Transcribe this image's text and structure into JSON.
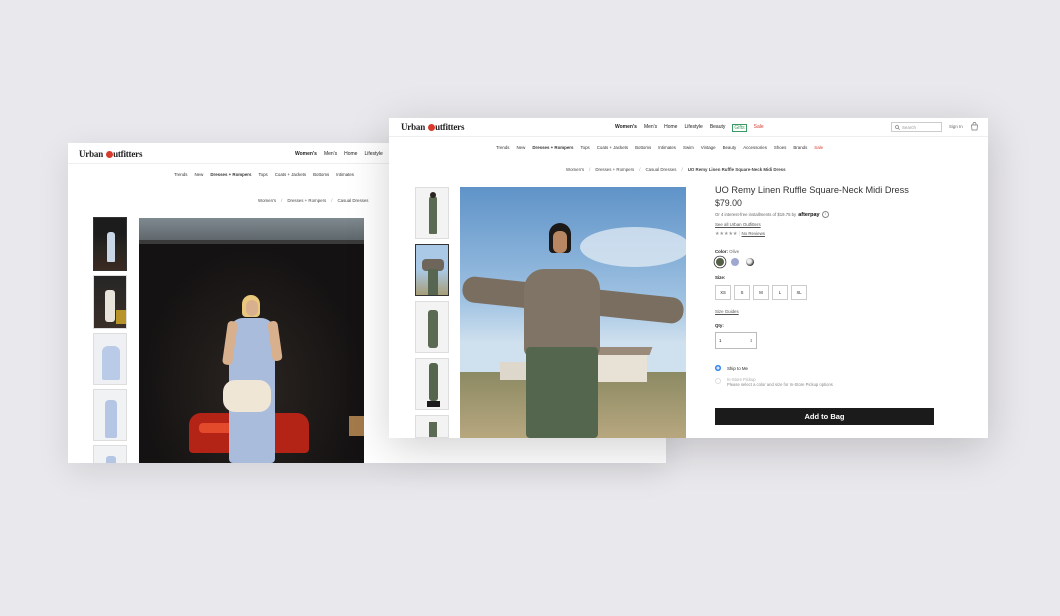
{
  "back_window": {
    "logo": {
      "pre": "Urban ",
      "post": "utfitters"
    },
    "top_nav": [
      "Women's",
      "Men's",
      "Home",
      "Lifestyle"
    ],
    "sub_nav": [
      "Trends",
      "New",
      "Dresses + Rompers",
      "Tops",
      "Coats + Jackets",
      "Bottoms",
      "Intimates"
    ],
    "breadcrumb": [
      "Women's",
      "Dresses + Rompers",
      "Casual Dresses"
    ]
  },
  "front_window": {
    "logo": {
      "pre": "Urban ",
      "post": "utfitters"
    },
    "top_nav": [
      "Women's",
      "Men's",
      "Home",
      "Lifestyle",
      "Beauty",
      "Gifts",
      "Sale"
    ],
    "search_placeholder": "Search",
    "sign_in": "Sign In",
    "sub_nav": [
      "Trends",
      "New",
      "Dresses + Rompers",
      "Tops",
      "Coats + Jackets",
      "Bottoms",
      "Intimates",
      "Swim",
      "Vintage",
      "Beauty",
      "Accessories",
      "Shoes",
      "Brands",
      "Sale"
    ],
    "breadcrumb": [
      "Women's",
      "Dresses + Rompers",
      "Casual Dresses",
      "UO Remy Linen Ruffle Square-Neck Midi Dress"
    ],
    "product": {
      "title": "UO Remy Linen Ruffle Square-Neck Midi Dress",
      "price": "$79.00",
      "installments": "Or 4 interest-free installments of $19.75 by",
      "afterpay": "afterpay",
      "see_all": "See all Urban Outfitters",
      "stars": "★★★★★",
      "reviews": "No Reviews",
      "color_label": "Color:",
      "color_value": "Olive",
      "size_label": "Size:",
      "sizes": [
        "XS",
        "S",
        "M",
        "L",
        "XL"
      ],
      "size_guides": "Size Guides",
      "qty_label": "Qty:",
      "qty_value": "1",
      "ship_to_me": "Ship to Me",
      "in_store_pickup": "In-Store Pickup",
      "pickup_note": "Please select a color and size for In-Store Pickup options",
      "add_to_bag": "Add to Bag"
    }
  },
  "colors": {
    "accent_red": "#d83a2c",
    "gifts_green": "#3b9a63",
    "button_black": "#1b1b1b",
    "radio_blue": "#2f80ed"
  }
}
